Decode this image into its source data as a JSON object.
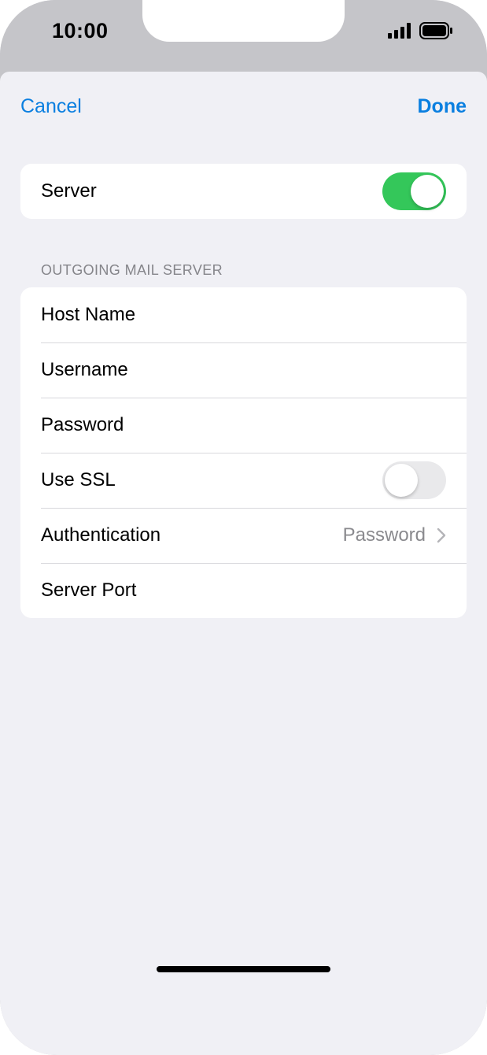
{
  "status_bar": {
    "time": "10:00",
    "signal_icon": "cellular-signal-icon",
    "battery_icon": "battery-icon"
  },
  "nav": {
    "cancel_label": "Cancel",
    "done_label": "Done"
  },
  "server_row": {
    "label": "Server",
    "toggle_on": true
  },
  "outgoing": {
    "header": "OUTGOING MAIL SERVER",
    "rows": {
      "host_name": {
        "label": "Host Name"
      },
      "username": {
        "label": "Username"
      },
      "password": {
        "label": "Password"
      },
      "use_ssl": {
        "label": "Use SSL",
        "toggle_on": false
      },
      "authentication": {
        "label": "Authentication",
        "value": "Password",
        "icon": "chevron-right-icon"
      },
      "server_port": {
        "label": "Server Port"
      }
    }
  },
  "colors": {
    "accent": "#0a7fe0",
    "toggle_on": "#34c75a",
    "toggle_off": "#e9e9eb",
    "background": "#f0f0f5",
    "secondary_text": "#8a8a8e"
  }
}
